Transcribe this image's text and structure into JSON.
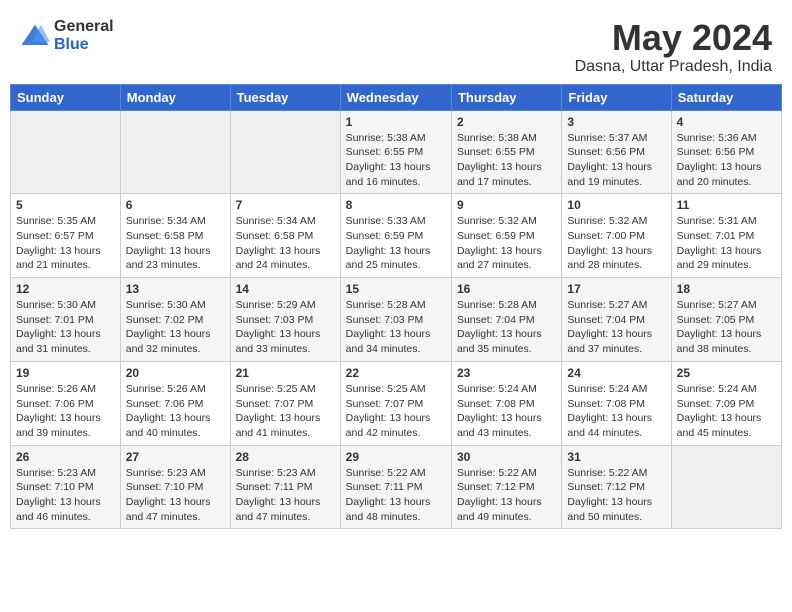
{
  "logo": {
    "general": "General",
    "blue": "Blue"
  },
  "header": {
    "month_year": "May 2024",
    "location": "Dasna, Uttar Pradesh, India"
  },
  "days_of_week": [
    "Sunday",
    "Monday",
    "Tuesday",
    "Wednesday",
    "Thursday",
    "Friday",
    "Saturday"
  ],
  "weeks": [
    {
      "days": [
        {
          "number": "",
          "info": ""
        },
        {
          "number": "",
          "info": ""
        },
        {
          "number": "",
          "info": ""
        },
        {
          "number": "1",
          "info": "Sunrise: 5:38 AM\nSunset: 6:55 PM\nDaylight: 13 hours and 16 minutes."
        },
        {
          "number": "2",
          "info": "Sunrise: 5:38 AM\nSunset: 6:55 PM\nDaylight: 13 hours and 17 minutes."
        },
        {
          "number": "3",
          "info": "Sunrise: 5:37 AM\nSunset: 6:56 PM\nDaylight: 13 hours and 19 minutes."
        },
        {
          "number": "4",
          "info": "Sunrise: 5:36 AM\nSunset: 6:56 PM\nDaylight: 13 hours and 20 minutes."
        }
      ]
    },
    {
      "days": [
        {
          "number": "5",
          "info": "Sunrise: 5:35 AM\nSunset: 6:57 PM\nDaylight: 13 hours and 21 minutes."
        },
        {
          "number": "6",
          "info": "Sunrise: 5:34 AM\nSunset: 6:58 PM\nDaylight: 13 hours and 23 minutes."
        },
        {
          "number": "7",
          "info": "Sunrise: 5:34 AM\nSunset: 6:58 PM\nDaylight: 13 hours and 24 minutes."
        },
        {
          "number": "8",
          "info": "Sunrise: 5:33 AM\nSunset: 6:59 PM\nDaylight: 13 hours and 25 minutes."
        },
        {
          "number": "9",
          "info": "Sunrise: 5:32 AM\nSunset: 6:59 PM\nDaylight: 13 hours and 27 minutes."
        },
        {
          "number": "10",
          "info": "Sunrise: 5:32 AM\nSunset: 7:00 PM\nDaylight: 13 hours and 28 minutes."
        },
        {
          "number": "11",
          "info": "Sunrise: 5:31 AM\nSunset: 7:01 PM\nDaylight: 13 hours and 29 minutes."
        }
      ]
    },
    {
      "days": [
        {
          "number": "12",
          "info": "Sunrise: 5:30 AM\nSunset: 7:01 PM\nDaylight: 13 hours and 31 minutes."
        },
        {
          "number": "13",
          "info": "Sunrise: 5:30 AM\nSunset: 7:02 PM\nDaylight: 13 hours and 32 minutes."
        },
        {
          "number": "14",
          "info": "Sunrise: 5:29 AM\nSunset: 7:03 PM\nDaylight: 13 hours and 33 minutes."
        },
        {
          "number": "15",
          "info": "Sunrise: 5:28 AM\nSunset: 7:03 PM\nDaylight: 13 hours and 34 minutes."
        },
        {
          "number": "16",
          "info": "Sunrise: 5:28 AM\nSunset: 7:04 PM\nDaylight: 13 hours and 35 minutes."
        },
        {
          "number": "17",
          "info": "Sunrise: 5:27 AM\nSunset: 7:04 PM\nDaylight: 13 hours and 37 minutes."
        },
        {
          "number": "18",
          "info": "Sunrise: 5:27 AM\nSunset: 7:05 PM\nDaylight: 13 hours and 38 minutes."
        }
      ]
    },
    {
      "days": [
        {
          "number": "19",
          "info": "Sunrise: 5:26 AM\nSunset: 7:06 PM\nDaylight: 13 hours and 39 minutes."
        },
        {
          "number": "20",
          "info": "Sunrise: 5:26 AM\nSunset: 7:06 PM\nDaylight: 13 hours and 40 minutes."
        },
        {
          "number": "21",
          "info": "Sunrise: 5:25 AM\nSunset: 7:07 PM\nDaylight: 13 hours and 41 minutes."
        },
        {
          "number": "22",
          "info": "Sunrise: 5:25 AM\nSunset: 7:07 PM\nDaylight: 13 hours and 42 minutes."
        },
        {
          "number": "23",
          "info": "Sunrise: 5:24 AM\nSunset: 7:08 PM\nDaylight: 13 hours and 43 minutes."
        },
        {
          "number": "24",
          "info": "Sunrise: 5:24 AM\nSunset: 7:08 PM\nDaylight: 13 hours and 44 minutes."
        },
        {
          "number": "25",
          "info": "Sunrise: 5:24 AM\nSunset: 7:09 PM\nDaylight: 13 hours and 45 minutes."
        }
      ]
    },
    {
      "days": [
        {
          "number": "26",
          "info": "Sunrise: 5:23 AM\nSunset: 7:10 PM\nDaylight: 13 hours and 46 minutes."
        },
        {
          "number": "27",
          "info": "Sunrise: 5:23 AM\nSunset: 7:10 PM\nDaylight: 13 hours and 47 minutes."
        },
        {
          "number": "28",
          "info": "Sunrise: 5:23 AM\nSunset: 7:11 PM\nDaylight: 13 hours and 47 minutes."
        },
        {
          "number": "29",
          "info": "Sunrise: 5:22 AM\nSunset: 7:11 PM\nDaylight: 13 hours and 48 minutes."
        },
        {
          "number": "30",
          "info": "Sunrise: 5:22 AM\nSunset: 7:12 PM\nDaylight: 13 hours and 49 minutes."
        },
        {
          "number": "31",
          "info": "Sunrise: 5:22 AM\nSunset: 7:12 PM\nDaylight: 13 hours and 50 minutes."
        },
        {
          "number": "",
          "info": ""
        }
      ]
    }
  ]
}
